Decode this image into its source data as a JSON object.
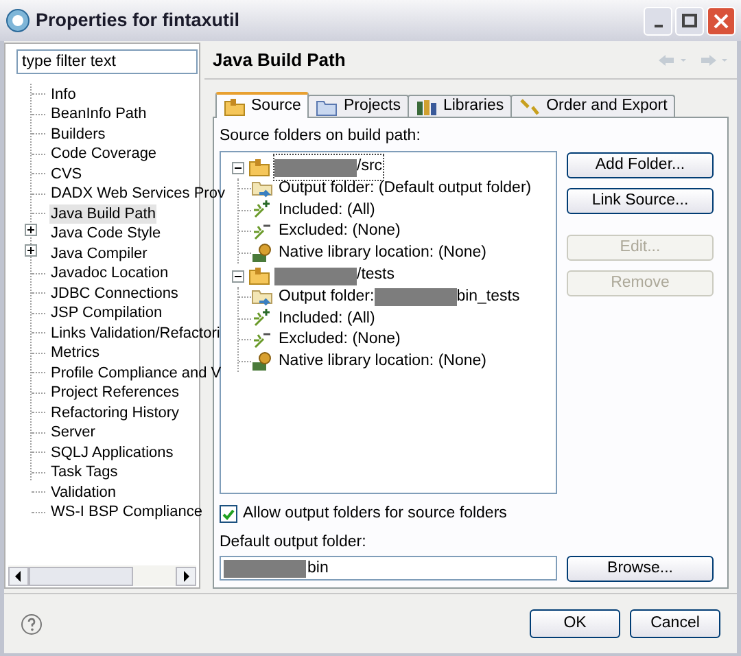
{
  "window": {
    "title": "Properties for fintaxutil"
  },
  "filter": {
    "placeholder": "type filter text"
  },
  "sidebar": {
    "items": [
      {
        "label": "Info",
        "kind": "leaf",
        "selected": false
      },
      {
        "label": "BeanInfo Path",
        "kind": "leaf",
        "selected": false
      },
      {
        "label": "Builders",
        "kind": "leaf",
        "selected": false
      },
      {
        "label": "Code Coverage",
        "kind": "leaf",
        "selected": false
      },
      {
        "label": "CVS",
        "kind": "leaf",
        "selected": false
      },
      {
        "label": "DADX Web Services Prov",
        "kind": "leaf",
        "selected": false
      },
      {
        "label": "Java Build Path",
        "kind": "leaf",
        "selected": true
      },
      {
        "label": "Java Code Style",
        "kind": "group",
        "selected": false
      },
      {
        "label": "Java Compiler",
        "kind": "group",
        "selected": false
      },
      {
        "label": "Javadoc Location",
        "kind": "leaf",
        "selected": false
      },
      {
        "label": "JDBC Connections",
        "kind": "leaf",
        "selected": false
      },
      {
        "label": "JSP Compilation",
        "kind": "leaf",
        "selected": false
      },
      {
        "label": "Links Validation/Refactori",
        "kind": "leaf",
        "selected": false
      },
      {
        "label": "Metrics",
        "kind": "leaf",
        "selected": false
      },
      {
        "label": "Profile Compliance and V",
        "kind": "leaf",
        "selected": false
      },
      {
        "label": "Project References",
        "kind": "leaf",
        "selected": false
      },
      {
        "label": "Refactoring History",
        "kind": "leaf",
        "selected": false
      },
      {
        "label": "Server",
        "kind": "leaf",
        "selected": false
      },
      {
        "label": "SQLJ Applications",
        "kind": "leaf",
        "selected": false
      },
      {
        "label": "Task Tags",
        "kind": "leaf",
        "selected": false
      },
      {
        "label": "Validation",
        "kind": "leaf",
        "selected": false
      },
      {
        "label": "WS-I BSP Compliance",
        "kind": "leaf",
        "selected": false
      }
    ]
  },
  "page": {
    "title": "Java Build Path"
  },
  "tabs": [
    {
      "label": "Source",
      "kind": "source",
      "selected": true
    },
    {
      "label": "Projects",
      "kind": "projects",
      "selected": false
    },
    {
      "label": "Libraries",
      "kind": "libraries",
      "selected": false
    },
    {
      "label": "Order and Export",
      "kind": "order",
      "selected": false
    }
  ],
  "source_label": "Source folders on build path:",
  "tree": [
    {
      "path": "/src",
      "selected": true,
      "expanded": true,
      "children": [
        {
          "kind": "output",
          "label": "Output folder: (Default output folder)"
        },
        {
          "kind": "included",
          "label": "Included: (All)"
        },
        {
          "kind": "excluded",
          "label": "Excluded: (None)"
        },
        {
          "kind": "native",
          "label": "Native library location: (None)"
        }
      ]
    },
    {
      "path": "/tests",
      "selected": false,
      "expanded": true,
      "children": [
        {
          "kind": "output",
          "label": "Output folder:",
          "redacted_value": "bin_tests"
        },
        {
          "kind": "included",
          "label": "Included: (All)"
        },
        {
          "kind": "excluded",
          "label": "Excluded: (None)"
        },
        {
          "kind": "native",
          "label": "Native library location: (None)"
        }
      ]
    }
  ],
  "side_buttons": [
    {
      "label": "Add Folder...",
      "disabled": false
    },
    {
      "label": "Link Source...",
      "disabled": false
    },
    {
      "label": "Edit...",
      "disabled": true
    },
    {
      "label": "Remove",
      "disabled": true
    }
  ],
  "allow_output": {
    "label": "Allow output folders for source folders",
    "checked": true
  },
  "default_output": {
    "label": "Default output folder:",
    "value": "bin",
    "browse": "Browse..."
  },
  "footer": {
    "buttons": [
      "OK",
      "Cancel"
    ]
  }
}
